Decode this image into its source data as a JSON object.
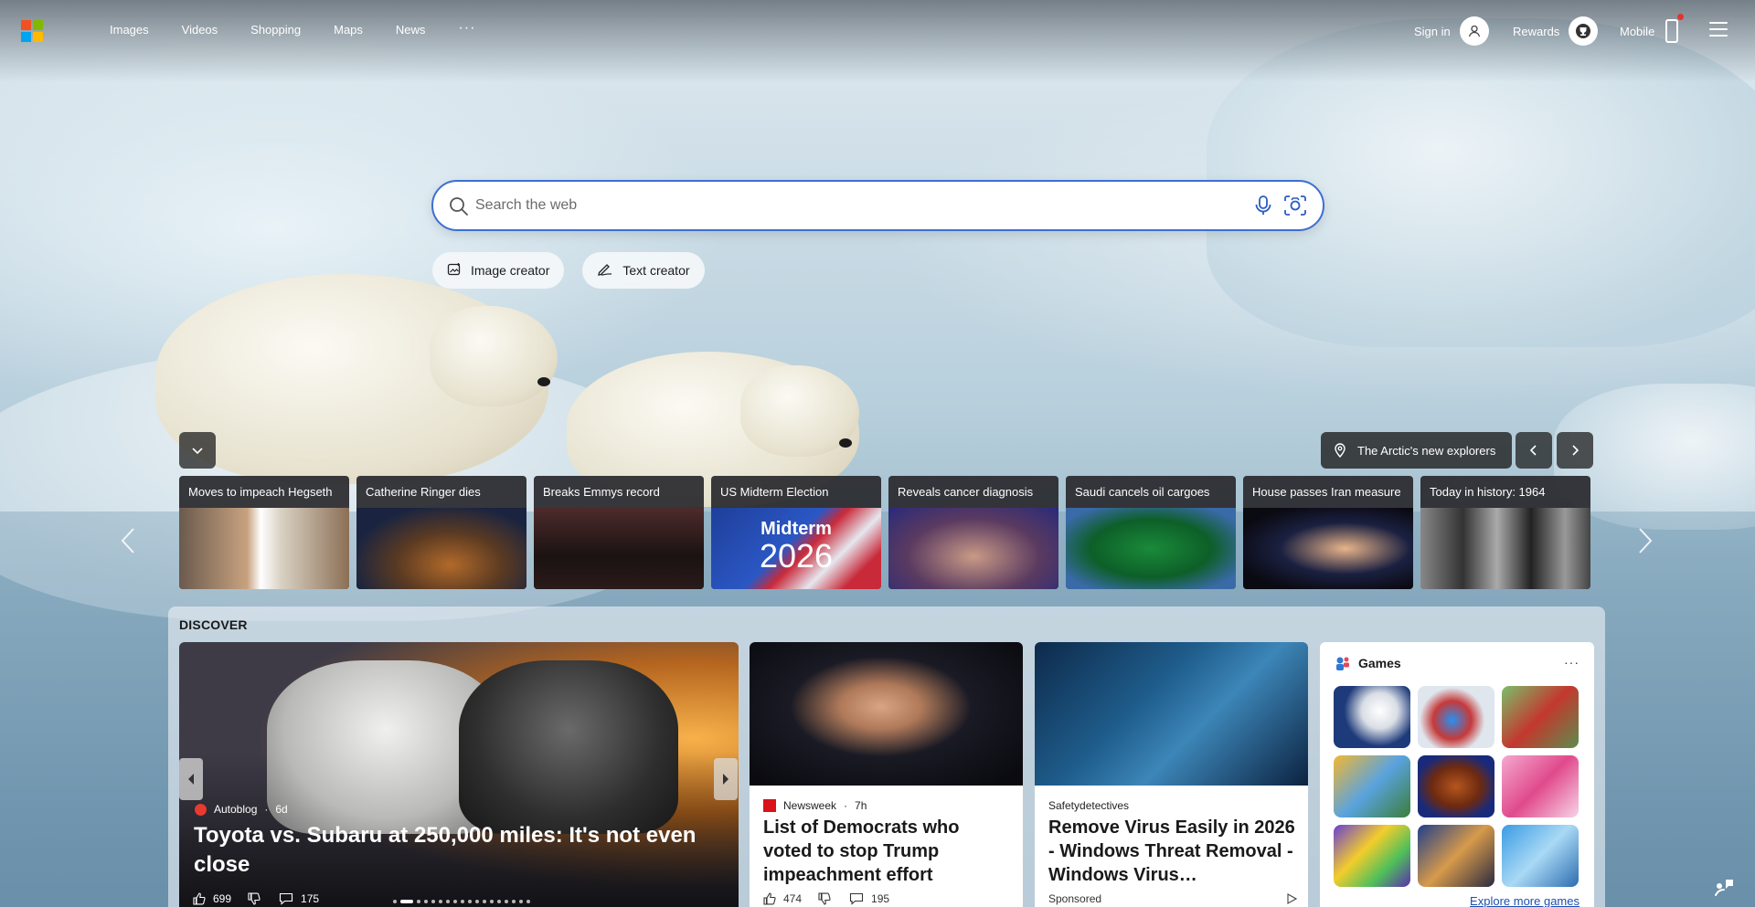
{
  "header": {
    "nav": [
      "Images",
      "Videos",
      "Shopping",
      "Maps",
      "News"
    ],
    "nav_more": "···",
    "sign_in": "Sign in",
    "rewards": "Rewards",
    "mobile": "Mobile"
  },
  "search": {
    "placeholder": "Search the web"
  },
  "chips": {
    "image_creator": "Image creator",
    "text_creator": "Text creator"
  },
  "image_of_day": {
    "caption": "The Arctic's new explorers"
  },
  "trending": [
    {
      "label": "Moves to impeach Hegseth"
    },
    {
      "label": "Catherine Ringer dies"
    },
    {
      "label": "Breaks Emmys record"
    },
    {
      "label": "US Midterm Election",
      "overlay_top": "Midterm",
      "overlay_bottom": "2026"
    },
    {
      "label": "Reveals cancer diagnosis"
    },
    {
      "label": "Saudi cancels oil cargoes"
    },
    {
      "label": "House passes Iran measure"
    },
    {
      "label": "Today in history: 1964"
    }
  ],
  "discover": {
    "title": "DISCOVER",
    "hero": {
      "source": "Autoblog",
      "age": "6d",
      "title": "Toyota vs. Subaru at 250,000 miles: It's not even close",
      "likes": "699",
      "comments": "175"
    },
    "cards": [
      {
        "source": "Newsweek",
        "age": "7h",
        "title": "List of Democrats who voted to stop Trump impeachment effort",
        "likes": "474",
        "comments": "195"
      },
      {
        "source": "Safetydetectives",
        "title": "Remove Virus Easily in 2026 - Windows Threat Removal - Windows Virus…",
        "sponsored": "Sponsored"
      }
    ],
    "games": {
      "title": "Games",
      "more": "···",
      "explore": "Explore more games"
    }
  },
  "colors": {
    "search_border": "#3c6fd3",
    "link": "#1b4fb0",
    "notification": "#e2352d"
  }
}
